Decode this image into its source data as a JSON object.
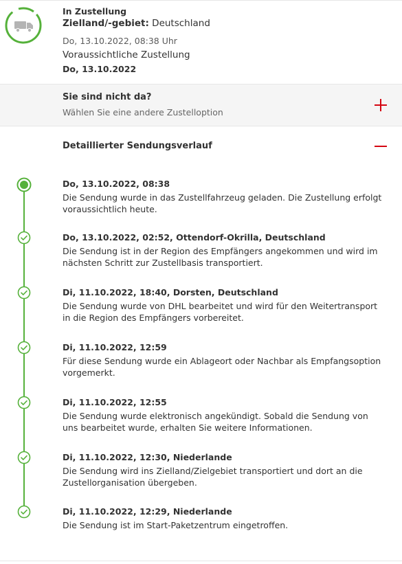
{
  "status": {
    "title": "In Zustellung",
    "destination_label": "Zielland/-gebiet:",
    "destination_value": "Deutschland",
    "timestamp": "Do, 13.10.2022, 08:38 Uhr",
    "expected_label": "Voraussichtliche Zustellung",
    "expected_date": "Do, 13.10.2022",
    "icon": "delivery-truck-icon",
    "progress_color": "#55b13a"
  },
  "absent": {
    "title": "Sie sind nicht da?",
    "subtitle": "Wählen Sie eine andere Zustelloption",
    "icon": "plus-icon"
  },
  "history": {
    "title": "Detaillierter Sendungsverlauf",
    "icon": "minus-icon",
    "events": [
      {
        "head": "Do, 13.10.2022, 08:38",
        "desc": "Die Sendung wurde in das Zustellfahrzeug geladen. Die Zustellung erfolgt voraussichtlich heute.",
        "state": "current"
      },
      {
        "head": "Do, 13.10.2022, 02:52, Ottendorf-Okrilla, Deutschland",
        "desc": "Die Sendung ist in der Region des Empfängers angekommen und wird im nächsten Schritt zur Zustellbasis transportiert.",
        "state": "done"
      },
      {
        "head": "Di, 11.10.2022, 18:40, Dorsten, Deutschland",
        "desc": "Die Sendung wurde von DHL bearbeitet und wird für den Weitertransport in die Region des Empfängers vorbereitet.",
        "state": "done"
      },
      {
        "head": "Di, 11.10.2022, 12:59",
        "desc": "Für diese Sendung wurde ein Ablageort oder Nachbar als Empfangsoption vorgemerkt.",
        "state": "done"
      },
      {
        "head": "Di, 11.10.2022, 12:55",
        "desc": "Die Sendung wurde elektronisch angekündigt. Sobald die Sendung von uns bearbeitet wurde, erhalten Sie weitere Informationen.",
        "state": "done"
      },
      {
        "head": "Di, 11.10.2022, 12:30, Niederlande",
        "desc": "Die Sendung wird ins Zielland/Zielgebiet transportiert und dort an die Zustellorganisation übergeben.",
        "state": "done"
      },
      {
        "head": "Di, 11.10.2022, 12:29, Niederlande",
        "desc": "Die Sendung ist im Start-Paketzentrum eingetroffen.",
        "state": "done"
      }
    ]
  },
  "colors": {
    "accent_red": "#d40511",
    "timeline_green": "#55b13a",
    "text": "#323232",
    "muted": "#666666"
  }
}
